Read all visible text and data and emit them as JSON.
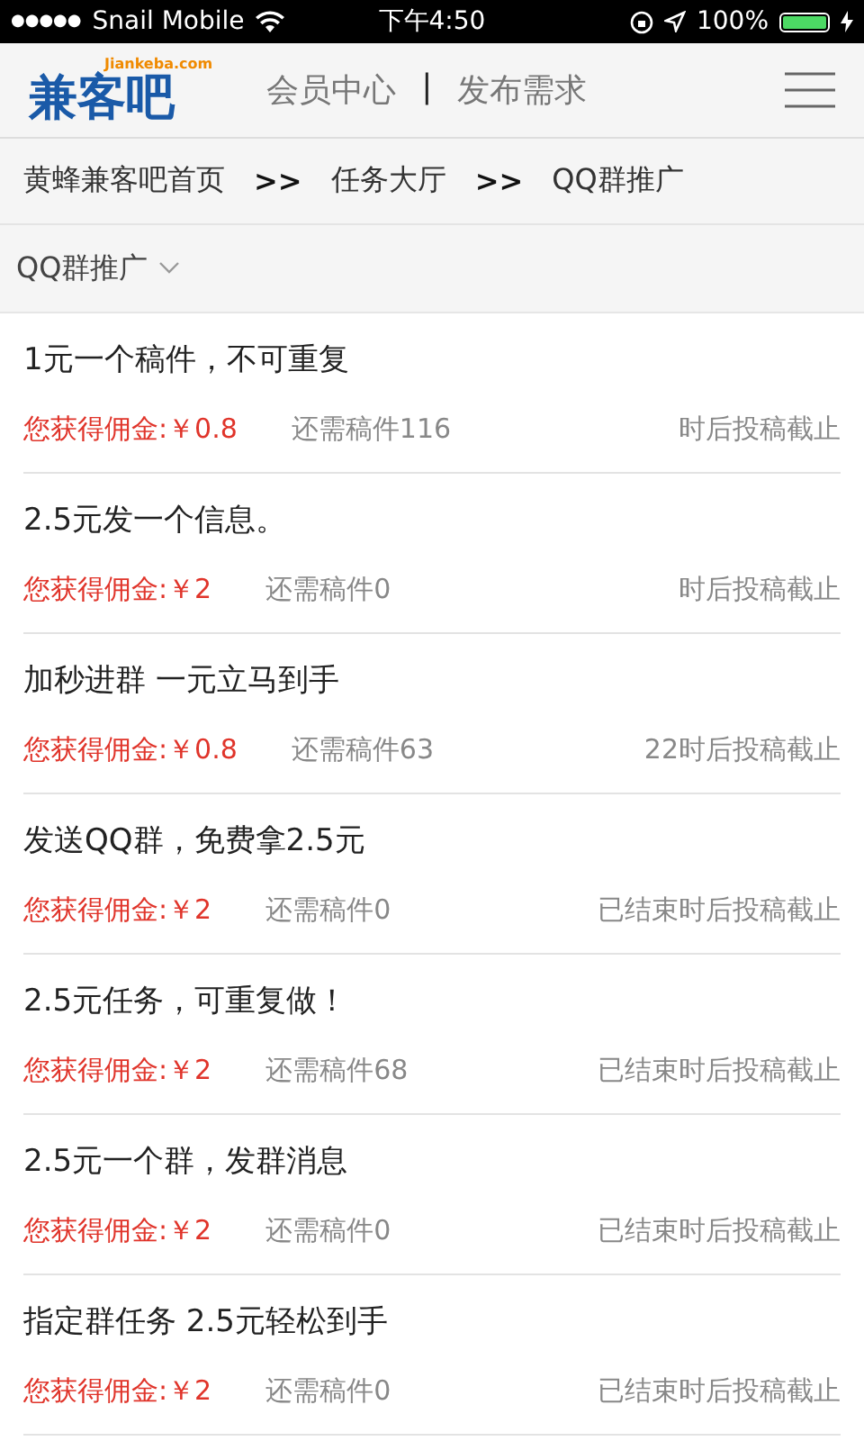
{
  "status_bar": {
    "signal_dots": "●●●●●",
    "carrier": "Snail Mobile",
    "time": "下午4:50",
    "battery": "100%"
  },
  "header": {
    "logo_domain": "Jiankeba.com",
    "logo_text": "兼客吧",
    "nav": [
      "会员中心",
      "|",
      "发布需求"
    ]
  },
  "breadcrumb": [
    "黄蜂兼客吧首页",
    ">>",
    "任务大厅",
    ">>",
    "QQ群推广"
  ],
  "filter": {
    "label": "QQ群推广"
  },
  "tasks": [
    {
      "title": "1元一个稿件，不可重复",
      "commission": "您获得佣金:￥0.8",
      "remaining": "还需稿件116",
      "deadline": "时后投稿截止"
    },
    {
      "title": "2.5元发一个信息。",
      "commission": "您获得佣金:￥2",
      "remaining": "还需稿件0",
      "deadline": "时后投稿截止"
    },
    {
      "title": "加秒进群 一元立马到手",
      "commission": "您获得佣金:￥0.8",
      "remaining": "还需稿件63",
      "deadline": "22时后投稿截止"
    },
    {
      "title": "发送QQ群，免费拿2.5元",
      "commission": "您获得佣金:￥2",
      "remaining": "还需稿件0",
      "deadline": "已结束时后投稿截止"
    },
    {
      "title": "2.5元任务，可重复做！",
      "commission": "您获得佣金:￥2",
      "remaining": "还需稿件68",
      "deadline": "已结束时后投稿截止"
    },
    {
      "title": "2.5元一个群，发群消息",
      "commission": "您获得佣金:￥2",
      "remaining": "还需稿件0",
      "deadline": "已结束时后投稿截止"
    },
    {
      "title": "指定群任务 2.5元轻松到手",
      "commission": "您获得佣金:￥2",
      "remaining": "还需稿件0",
      "deadline": "已结束时后投稿截止"
    }
  ]
}
